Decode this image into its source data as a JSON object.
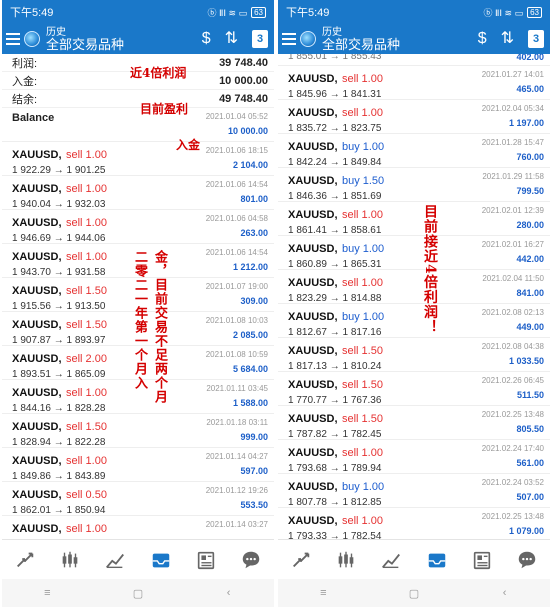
{
  "status": {
    "time": "下午5:49",
    "icons": "ⓑ ⅡⅠ ≋ ▭",
    "battery": "63"
  },
  "appbar": {
    "subtitle": "历史",
    "title": "全部交易品种",
    "calendar_day": "3",
    "sort_icon": "⇅",
    "dollar_icon": "$"
  },
  "summary": [
    {
      "label": "利润:",
      "value": "39 748.40"
    },
    {
      "label": "入金:",
      "value": "10 000.00"
    },
    {
      "label": "结余:",
      "value": "49 748.40"
    }
  ],
  "balance": {
    "label": "Balance",
    "time": "2021.01.04 05:52",
    "amount": "10 000.00"
  },
  "left_trades": [
    {
      "symbol": "XAUUSD,",
      "side": "sell 1.00",
      "type": "sell",
      "prices": "1 922.29 → 1 901.25",
      "time": "2021.01.06 18:15",
      "pl": "2 104.00"
    },
    {
      "symbol": "XAUUSD,",
      "side": "sell 1.00",
      "type": "sell",
      "prices": "1 940.04 → 1 932.03",
      "time": "2021.01.06 14:54",
      "pl": "801.00"
    },
    {
      "symbol": "XAUUSD,",
      "side": "sell 1.00",
      "type": "sell",
      "prices": "1 946.69 → 1 944.06",
      "time": "2021.01.06 04:58",
      "pl": "263.00"
    },
    {
      "symbol": "XAUUSD,",
      "side": "sell 1.00",
      "type": "sell",
      "prices": "1 943.70 → 1 931.58",
      "time": "2021.01.06 14:54",
      "pl": "1 212.00"
    },
    {
      "symbol": "XAUUSD,",
      "side": "sell 1.50",
      "type": "sell",
      "prices": "1 915.56 → 1 913.50",
      "time": "2021.01.07 19:00",
      "pl": "309.00"
    },
    {
      "symbol": "XAUUSD,",
      "side": "sell 1.50",
      "type": "sell",
      "prices": "1 907.87 → 1 893.97",
      "time": "2021.01.08 10:03",
      "pl": "2 085.00"
    },
    {
      "symbol": "XAUUSD,",
      "side": "sell 2.00",
      "type": "sell",
      "prices": "1 893.51 → 1 865.09",
      "time": "2021.01.08 10:59",
      "pl": "5 684.00"
    },
    {
      "symbol": "XAUUSD,",
      "side": "sell 1.00",
      "type": "sell",
      "prices": "1 844.16 → 1 828.28",
      "time": "2021.01.11 03:45",
      "pl": "1 588.00"
    },
    {
      "symbol": "XAUUSD,",
      "side": "sell 1.50",
      "type": "sell",
      "prices": "1 828.94 → 1 822.28",
      "time": "2021.01.18 03:11",
      "pl": "999.00"
    },
    {
      "symbol": "XAUUSD,",
      "side": "sell 1.00",
      "type": "sell",
      "prices": "1 849.86 → 1 843.89",
      "time": "2021.01.14 04:27",
      "pl": "597.00"
    },
    {
      "symbol": "XAUUSD,",
      "side": "sell 0.50",
      "type": "sell",
      "prices": "1 862.01 → 1 850.94",
      "time": "2021.01.12 19:26",
      "pl": "553.50"
    },
    {
      "symbol": "XAUUSD,",
      "side": "sell 1.00",
      "type": "sell",
      "prices": "",
      "time": "2021.01.14 03:27",
      "pl": ""
    }
  ],
  "right_top_partial": "1 855.01 → 1 855.43",
  "right_top_pl": "402.00",
  "right_trades": [
    {
      "symbol": "XAUUSD,",
      "side": "sell 1.00",
      "type": "sell",
      "prices": "1 845.96 → 1 841.31",
      "time": "2021.01.27 14:01",
      "pl": "465.00"
    },
    {
      "symbol": "XAUUSD,",
      "side": "sell 1.00",
      "type": "sell",
      "prices": "1 835.72 → 1 823.75",
      "time": "2021.02.04 05:34",
      "pl": "1 197.00"
    },
    {
      "symbol": "XAUUSD,",
      "side": "buy 1.00",
      "type": "buy",
      "prices": "1 842.24 → 1 849.84",
      "time": "2021.01.28 15:47",
      "pl": "760.00"
    },
    {
      "symbol": "XAUUSD,",
      "side": "buy 1.50",
      "type": "buy",
      "prices": "1 846.36 → 1 851.69",
      "time": "2021.01.29 11:58",
      "pl": "799.50"
    },
    {
      "symbol": "XAUUSD,",
      "side": "sell 1.00",
      "type": "sell",
      "prices": "1 861.41 → 1 858.61",
      "time": "2021.02.01 12:39",
      "pl": "280.00"
    },
    {
      "symbol": "XAUUSD,",
      "side": "buy 1.00",
      "type": "buy",
      "prices": "1 860.89 → 1 865.31",
      "time": "2021.02.01 16:27",
      "pl": "442.00"
    },
    {
      "symbol": "XAUUSD,",
      "side": "sell 1.00",
      "type": "sell",
      "prices": "1 823.29 → 1 814.88",
      "time": "2021.02.04 11:50",
      "pl": "841.00"
    },
    {
      "symbol": "XAUUSD,",
      "side": "buy 1.00",
      "type": "buy",
      "prices": "1 812.67 → 1 817.16",
      "time": "2021.02.08 02:13",
      "pl": "449.00"
    },
    {
      "symbol": "XAUUSD,",
      "side": "sell 1.50",
      "type": "sell",
      "prices": "1 817.13 → 1 810.24",
      "time": "2021.02.08 04:38",
      "pl": "1 033.50"
    },
    {
      "symbol": "XAUUSD,",
      "side": "sell 1.50",
      "type": "sell",
      "prices": "1 770.77 → 1 767.36",
      "time": "2021.02.26 06:45",
      "pl": "511.50"
    },
    {
      "symbol": "XAUUSD,",
      "side": "sell 1.50",
      "type": "sell",
      "prices": "1 787.82 → 1 782.45",
      "time": "2021.02.25 13:48",
      "pl": "805.50"
    },
    {
      "symbol": "XAUUSD,",
      "side": "sell 1.00",
      "type": "sell",
      "prices": "1 793.68 → 1 789.94",
      "time": "2021.02.24 17:40",
      "pl": "561.00"
    },
    {
      "symbol": "XAUUSD,",
      "side": "buy 1.00",
      "type": "buy",
      "prices": "1 807.78 → 1 812.85",
      "time": "2021.02.24 03:52",
      "pl": "507.00"
    },
    {
      "symbol": "XAUUSD,",
      "side": "sell 1.00",
      "type": "sell",
      "prices": "1 793.33 → 1 782.54",
      "time": "2021.02.25 13:48",
      "pl": "1 079.00"
    }
  ],
  "annotations": {
    "profit_note": "近4倍利润",
    "current_profit": "目前盈利",
    "deposit": "入金",
    "left_vertical_1": "金，目前交易不足两个月",
    "left_vertical_2": "二零二一年第一个月入",
    "right_vertical_1": "目前接近4倍利润！"
  },
  "navbar": {
    "menu": "≡",
    "home": "▢",
    "back": "‹"
  },
  "colors": {
    "accent": "#1a78c9",
    "sell": "#e53232",
    "buy": "#1e5ecf",
    "annotation": "#d40000"
  }
}
